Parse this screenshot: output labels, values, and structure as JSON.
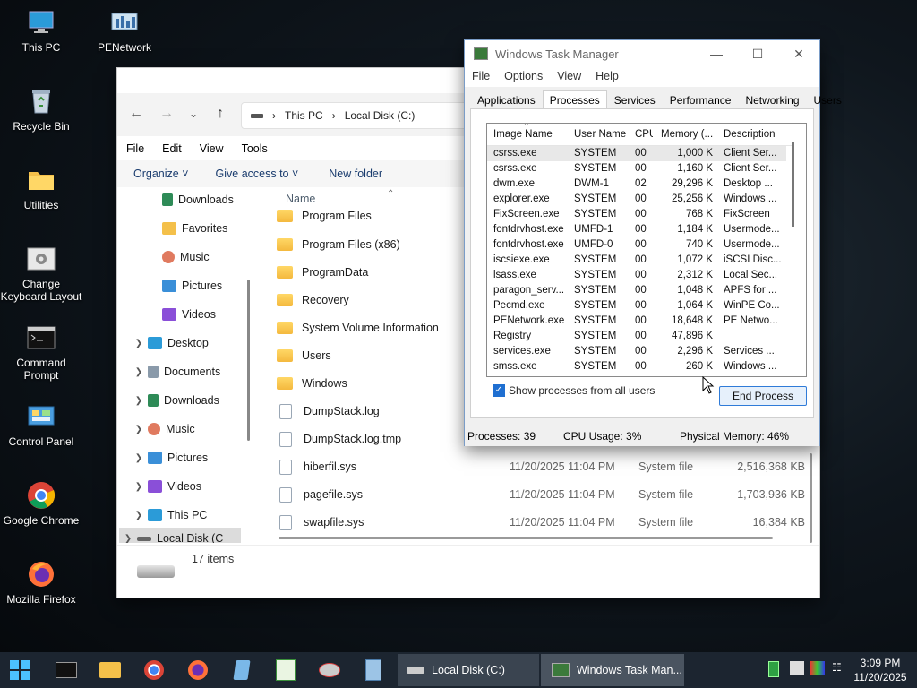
{
  "desktop": {
    "icons": [
      "This PC",
      "PENetwork",
      "Recycle Bin",
      "Utilities",
      "Change Keyboard Layout",
      "Command Prompt",
      "Control Panel",
      "Google Chrome",
      "Mozilla Firefox"
    ]
  },
  "explorer": {
    "address": [
      "This PC",
      "Local Disk (C:)"
    ],
    "menu": [
      "File",
      "Edit",
      "View",
      "Tools"
    ],
    "toolbar": [
      "Organize",
      "Give access to",
      "New folder"
    ],
    "tree": [
      "Downloads",
      "Favorites",
      "Music",
      "Pictures",
      "Videos",
      "Desktop",
      "Documents",
      "Downloads",
      "Music",
      "Pictures",
      "Videos",
      "This PC",
      "Local Disk (C"
    ],
    "column_name": "Name",
    "files": [
      {
        "name": "Program Files",
        "date": "",
        "type": "",
        "size": ""
      },
      {
        "name": "Program Files (x86)",
        "date": "",
        "type": "",
        "size": ""
      },
      {
        "name": "ProgramData",
        "date": "",
        "type": "",
        "size": ""
      },
      {
        "name": "Recovery",
        "date": "",
        "type": "",
        "size": ""
      },
      {
        "name": "System Volume Information",
        "date": "",
        "type": "",
        "size": ""
      },
      {
        "name": "Users",
        "date": "",
        "type": "",
        "size": ""
      },
      {
        "name": "Windows",
        "date": "",
        "type": "",
        "size": ""
      },
      {
        "name": "DumpStack.log",
        "date": "",
        "type": "",
        "size": ""
      },
      {
        "name": "DumpStack.log.tmp",
        "date": "",
        "type": "",
        "size": ""
      },
      {
        "name": "hiberfil.sys",
        "date": "11/20/2025 11:04 PM",
        "type": "System file",
        "size": "2,516,368 KB"
      },
      {
        "name": "pagefile.sys",
        "date": "11/20/2025 11:04 PM",
        "type": "System file",
        "size": "1,703,936 KB"
      },
      {
        "name": "swapfile.sys",
        "date": "11/20/2025 11:04 PM",
        "type": "System file",
        "size": "16,384 KB"
      }
    ],
    "status": "17 items"
  },
  "taskmanager": {
    "title": "Windows Task Manager",
    "menu": [
      "File",
      "Options",
      "View",
      "Help"
    ],
    "tabs": [
      "Applications",
      "Processes",
      "Services",
      "Performance",
      "Networking",
      "Users"
    ],
    "columns": [
      "Image Name",
      "User Name",
      "CPU",
      "Memory (...",
      "Description"
    ],
    "processes": [
      [
        "csrss.exe",
        "SYSTEM",
        "00",
        "1,000 K",
        "Client Ser..."
      ],
      [
        "csrss.exe",
        "SYSTEM",
        "00",
        "1,160 K",
        "Client Ser..."
      ],
      [
        "dwm.exe",
        "DWM-1",
        "02",
        "29,296 K",
        "Desktop ..."
      ],
      [
        "explorer.exe",
        "SYSTEM",
        "00",
        "25,256 K",
        "Windows ..."
      ],
      [
        "FixScreen.exe",
        "SYSTEM",
        "00",
        "768 K",
        "FixScreen"
      ],
      [
        "fontdrvhost.exe",
        "UMFD-1",
        "00",
        "1,184 K",
        "Usermode..."
      ],
      [
        "fontdrvhost.exe",
        "UMFD-0",
        "00",
        "740 K",
        "Usermode..."
      ],
      [
        "iscsiexe.exe",
        "SYSTEM",
        "00",
        "1,072 K",
        "iSCSI Disc..."
      ],
      [
        "lsass.exe",
        "SYSTEM",
        "00",
        "2,312 K",
        "Local Sec..."
      ],
      [
        "paragon_serv...",
        "SYSTEM",
        "00",
        "1,048 K",
        "APFS for ..."
      ],
      [
        "Pecmd.exe",
        "SYSTEM",
        "00",
        "1,064 K",
        "WinPE Co..."
      ],
      [
        "PENetwork.exe",
        "SYSTEM",
        "00",
        "18,648 K",
        "PE Netwo..."
      ],
      [
        "Registry",
        "SYSTEM",
        "00",
        "47,896 K",
        ""
      ],
      [
        "services.exe",
        "SYSTEM",
        "00",
        "2,296 K",
        "Services ..."
      ],
      [
        "smss.exe",
        "SYSTEM",
        "00",
        "260 K",
        "Windows ..."
      ]
    ],
    "show_all_label": "Show processes from all users",
    "end_process_label": "End Process",
    "status": {
      "processes": "Processes: 39",
      "cpu": "CPU Usage: 3%",
      "memory": "Physical Memory: 46%"
    }
  },
  "taskbar": {
    "tasks": [
      {
        "label": "Local Disk (C:)"
      },
      {
        "label": "Windows Task Man..."
      }
    ],
    "time": "3:09 PM",
    "date": "11/20/2025"
  }
}
